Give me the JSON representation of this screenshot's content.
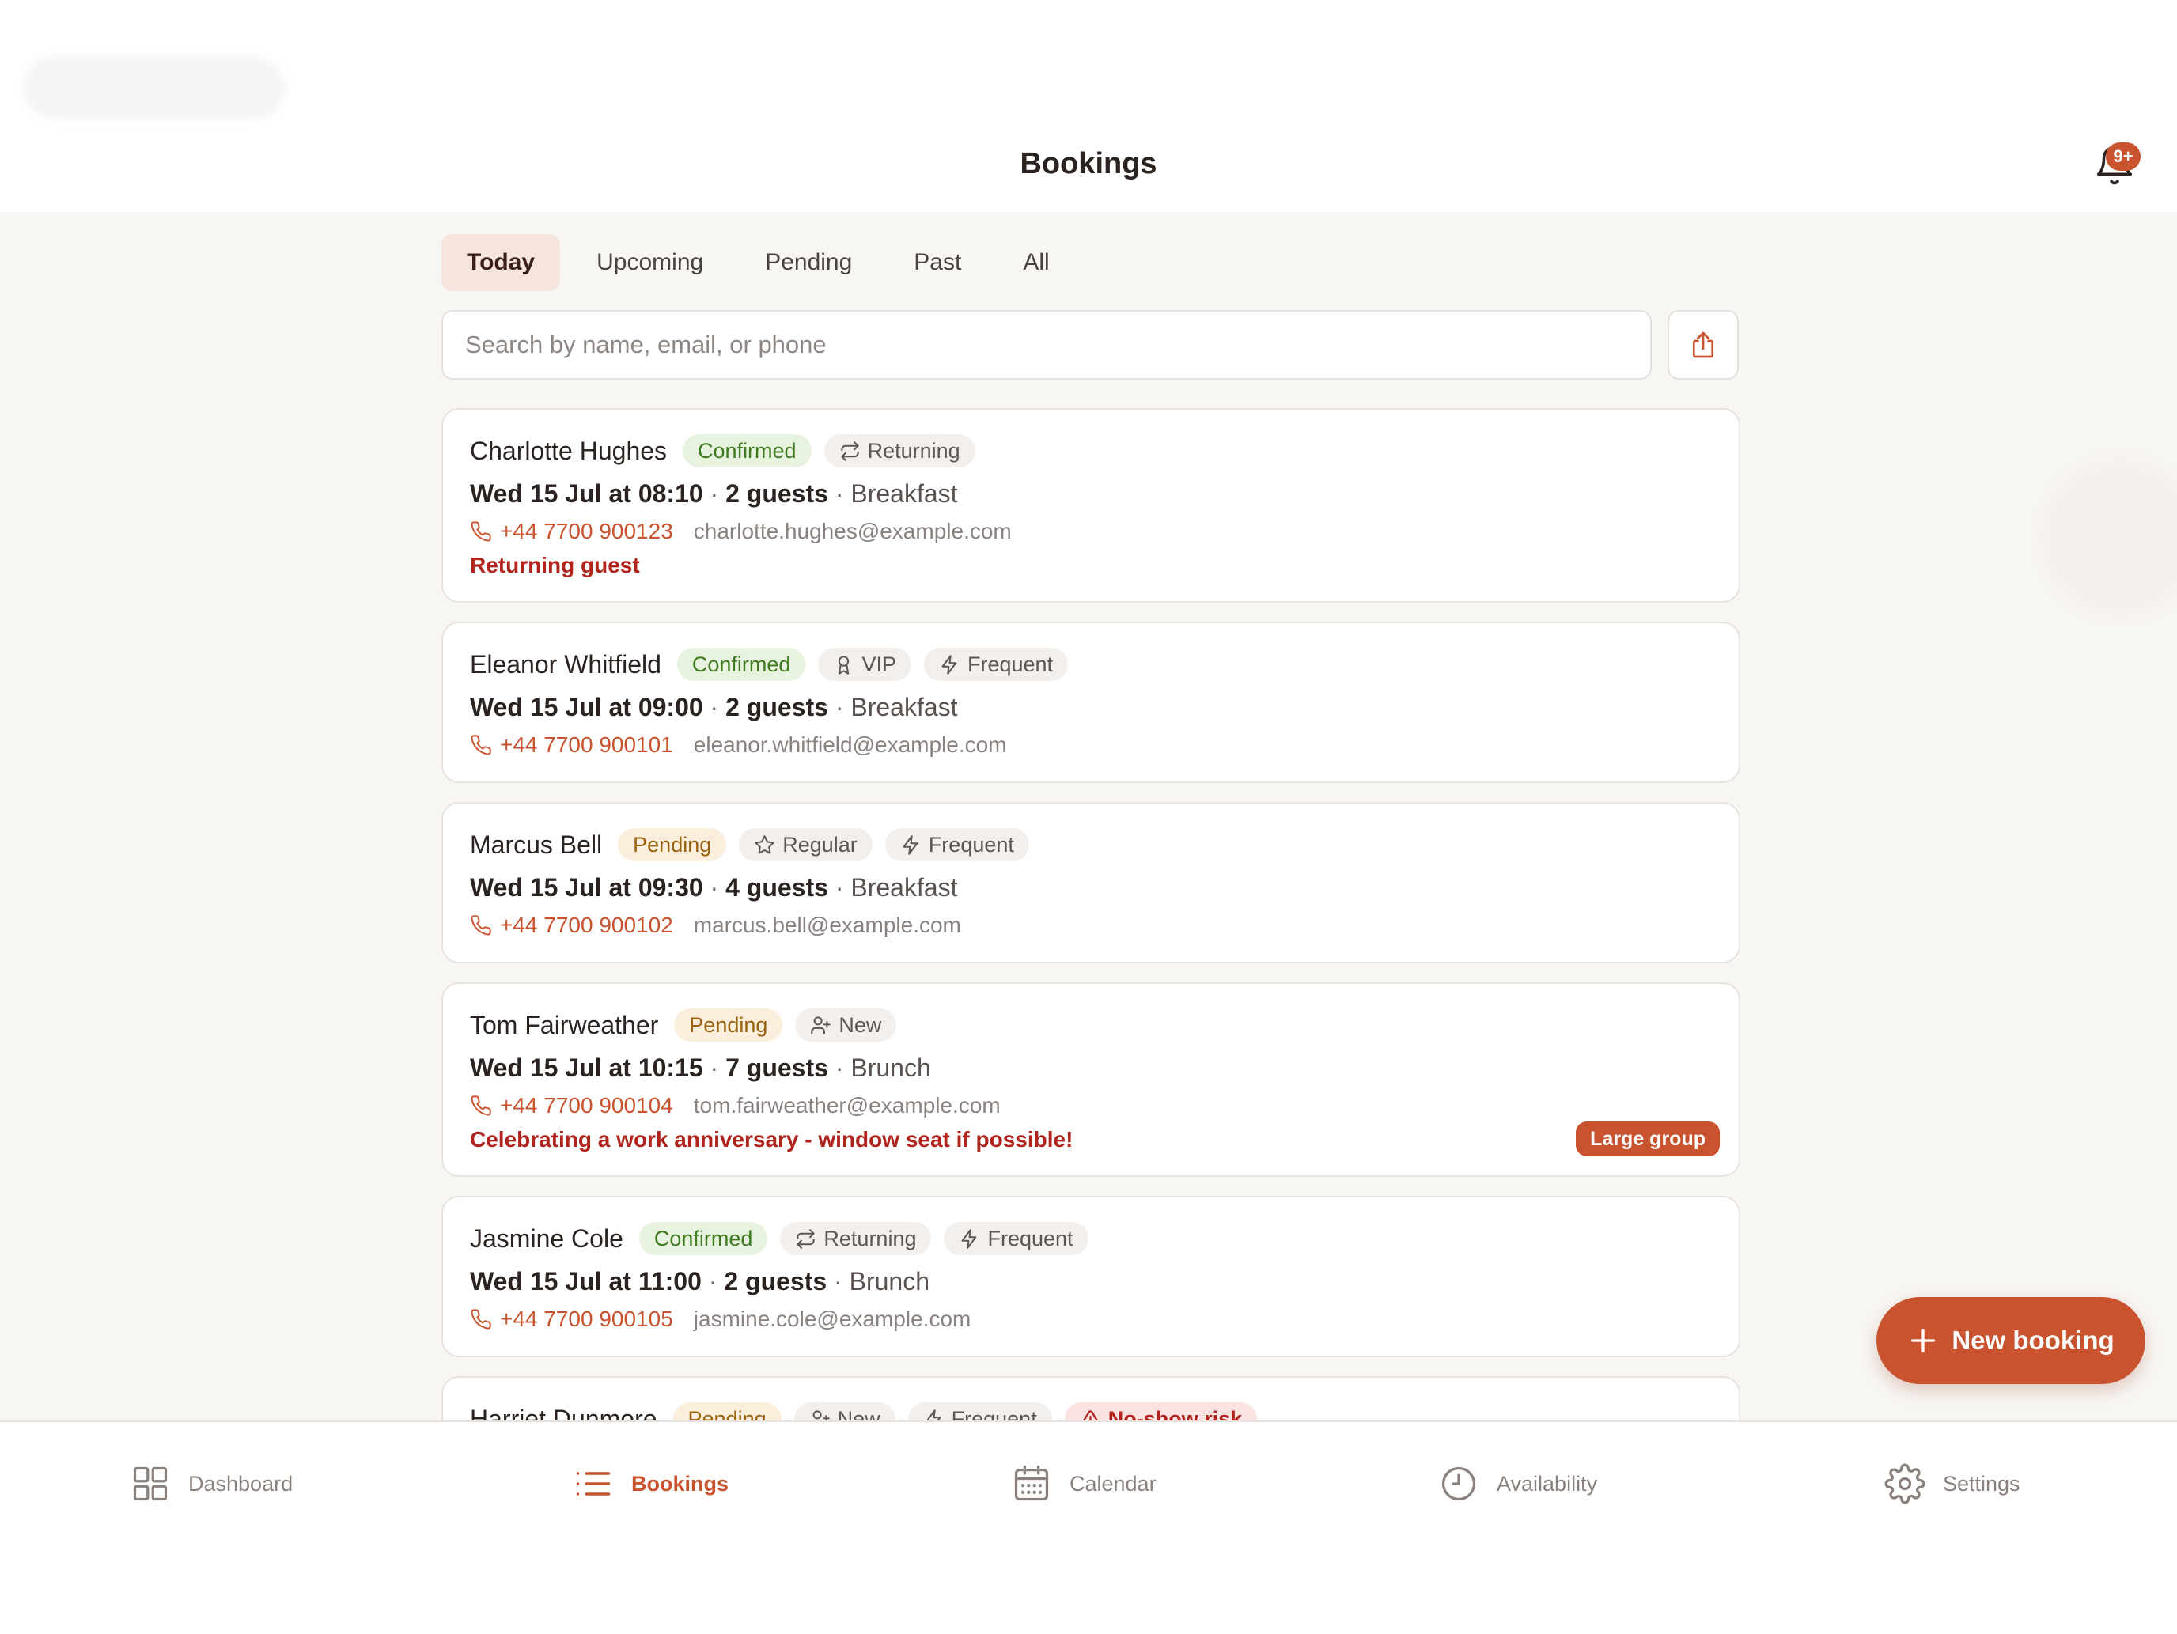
{
  "header": {
    "title": "Bookings",
    "notification_badge": "9+"
  },
  "tabs": [
    {
      "label": "Today",
      "active": true
    },
    {
      "label": "Upcoming",
      "active": false
    },
    {
      "label": "Pending",
      "active": false
    },
    {
      "label": "Past",
      "active": false
    },
    {
      "label": "All",
      "active": false
    }
  ],
  "search": {
    "placeholder": "Search by name, email, or phone",
    "value": ""
  },
  "bookings": [
    {
      "name": "Charlotte Hughes",
      "status": "Confirmed",
      "tags": [
        {
          "icon": "repeat-icon",
          "label": "Returning"
        }
      ],
      "when": "Wed 15 Jul at 08:10",
      "guests": "2 guests",
      "meal": "Breakfast",
      "phone": "+44 7700 900123",
      "email": "charlotte.hughes@example.com",
      "note": "Returning guest"
    },
    {
      "name": "Eleanor Whitfield",
      "status": "Confirmed",
      "tags": [
        {
          "icon": "award-icon",
          "label": "VIP"
        },
        {
          "icon": "bolt-icon",
          "label": "Frequent"
        }
      ],
      "when": "Wed 15 Jul at 09:00",
      "guests": "2 guests",
      "meal": "Breakfast",
      "phone": "+44 7700 900101",
      "email": "eleanor.whitfield@example.com"
    },
    {
      "name": "Marcus Bell",
      "status": "Pending",
      "tags": [
        {
          "icon": "star-icon",
          "label": "Regular"
        },
        {
          "icon": "bolt-icon",
          "label": "Frequent"
        }
      ],
      "when": "Wed 15 Jul at 09:30",
      "guests": "4 guests",
      "meal": "Breakfast",
      "phone": "+44 7700 900102",
      "email": "marcus.bell@example.com"
    },
    {
      "name": "Tom Fairweather",
      "status": "Pending",
      "tags": [
        {
          "icon": "user-plus-icon",
          "label": "New"
        }
      ],
      "when": "Wed 15 Jul at 10:15",
      "guests": "7 guests",
      "meal": "Brunch",
      "phone": "+44 7700 900104",
      "email": "tom.fairweather@example.com",
      "note": "Celebrating a work anniversary - window seat if possible!",
      "badge": "Large group"
    },
    {
      "name": "Jasmine Cole",
      "status": "Confirmed",
      "tags": [
        {
          "icon": "repeat-icon",
          "label": "Returning"
        },
        {
          "icon": "bolt-icon",
          "label": "Frequent"
        }
      ],
      "when": "Wed 15 Jul at 11:00",
      "guests": "2 guests",
      "meal": "Brunch",
      "phone": "+44 7700 900105",
      "email": "jasmine.cole@example.com"
    },
    {
      "name": "Harriet Dunmore",
      "status": "Pending",
      "tags": [
        {
          "icon": "user-plus-icon",
          "label": "New"
        },
        {
          "icon": "bolt-icon",
          "label": "Frequent"
        }
      ],
      "risk": "No-show risk"
    }
  ],
  "fab": {
    "label": "New booking"
  },
  "nav": [
    {
      "label": "Dashboard",
      "icon": "grid-icon",
      "active": false
    },
    {
      "label": "Bookings",
      "icon": "list-icon",
      "active": true
    },
    {
      "label": "Calendar",
      "icon": "calendar-icon",
      "active": false
    },
    {
      "label": "Availability",
      "icon": "clock-icon",
      "active": false
    },
    {
      "label": "Settings",
      "icon": "gear-icon",
      "active": false
    }
  ],
  "colors": {
    "accent": "#c9532f",
    "confirmed_bg": "#e8f3df",
    "confirmed_text": "#3e7a1f",
    "pending_bg": "#fbeedd",
    "pending_text": "#99620f",
    "risk_text": "#b0241d"
  }
}
